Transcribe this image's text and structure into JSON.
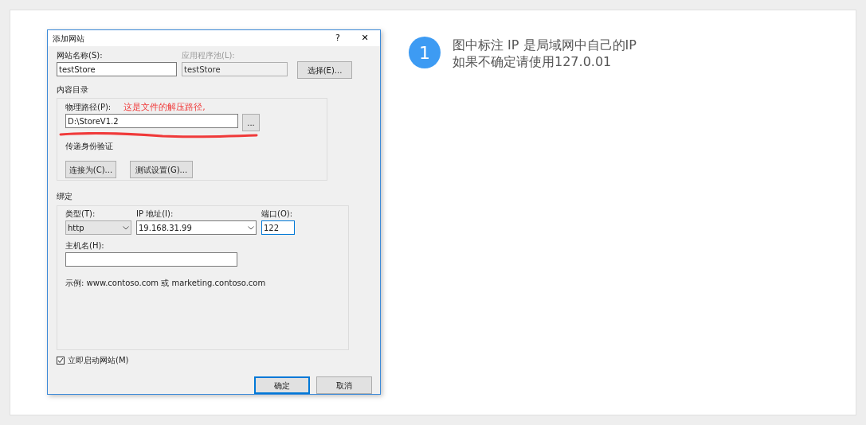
{
  "dialog": {
    "title": "添加网站",
    "help": "?",
    "close": "✕",
    "site_name": {
      "label": "网站名称(S):",
      "value": "testStore"
    },
    "app_pool": {
      "label": "应用程序池(L):",
      "value": "testStore",
      "disabled": true
    },
    "select_button": "选择(E)...",
    "content": {
      "legend": "内容目录",
      "path_label": "物理路径(P):",
      "annotation": "这是文件的解压路径,",
      "path_value": "D:\\StoreV1.2",
      "browse": "...",
      "auth_label": "传递身份验证",
      "connect_button": "连接为(C)...",
      "test_button": "测试设置(G)..."
    },
    "binding": {
      "legend": "绑定",
      "type_label": "类型(T):",
      "type_value": "http",
      "ip_label": "IP 地址(I):",
      "ip_value": "19.168.31.99",
      "port_label": "端口(O):",
      "port_value": "122",
      "host_label": "主机名(H):",
      "example": "示例: www.contoso.com 或 marketing.contoso.com"
    },
    "start": {
      "label": "立即启动网站(M)",
      "checked": true
    },
    "buttons": [
      {
        "label": "确定",
        "selected": true
      },
      {
        "label": "取消",
        "selected": false
      }
    ]
  },
  "note": {
    "number": "1",
    "lines": [
      "图中标注 IP 是局域网中自己的IP",
      "如果不确定请使用127.0.01"
    ]
  }
}
